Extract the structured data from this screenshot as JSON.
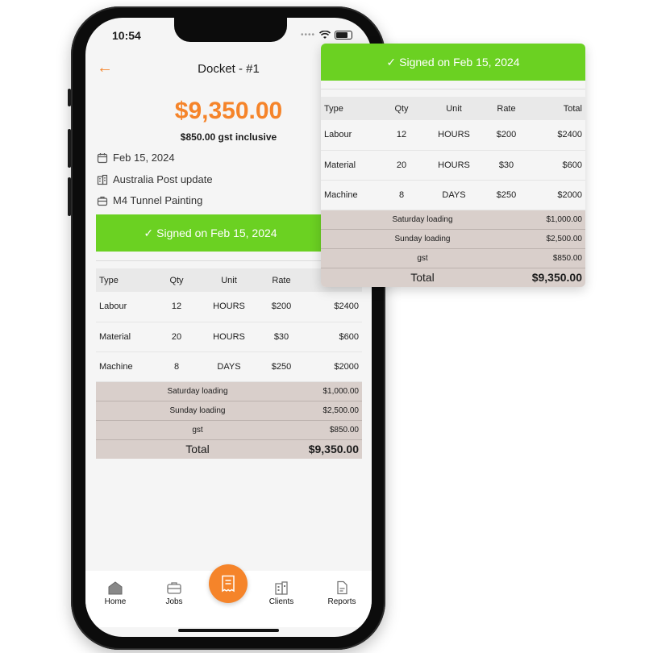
{
  "status": {
    "time": "10:54"
  },
  "header": {
    "back_glyph": "←",
    "title": "Docket - #1"
  },
  "summary": {
    "amount": "$9,350.00",
    "gst_note": "$850.00 gst inclusive"
  },
  "details": {
    "date": "Feb 15, 2024",
    "client": "Australia Post update",
    "job": "M4 Tunnel Painting"
  },
  "signed": {
    "label": "Signed on Feb 15, 2024"
  },
  "table": {
    "headers": {
      "type": "Type",
      "qty": "Qty",
      "unit": "Unit",
      "rate": "Rate",
      "total": "Total"
    },
    "rows": [
      {
        "type": "Labour",
        "qty": "12",
        "unit": "HOURS",
        "rate": "$200",
        "total": "$2400"
      },
      {
        "type": "Material",
        "qty": "20",
        "unit": "HOURS",
        "rate": "$30",
        "total": "$600"
      },
      {
        "type": "Machine",
        "qty": "8",
        "unit": "DAYS",
        "rate": "$250",
        "total": "$2000"
      }
    ],
    "adjustments": [
      {
        "label": "Saturday loading",
        "value": "$1,000.00"
      },
      {
        "label": "Sunday loading",
        "value": "$2,500.00"
      },
      {
        "label": "gst",
        "value": "$850.00"
      }
    ],
    "total": {
      "label": "Total",
      "value": "$9,350.00"
    }
  },
  "nav": {
    "home": "Home",
    "jobs": "Jobs",
    "clients": "Clients",
    "reports": "Reports"
  },
  "colors": {
    "accent": "#f5842a",
    "signed": "#6bd122",
    "summary_bg": "#d9cfcb"
  }
}
